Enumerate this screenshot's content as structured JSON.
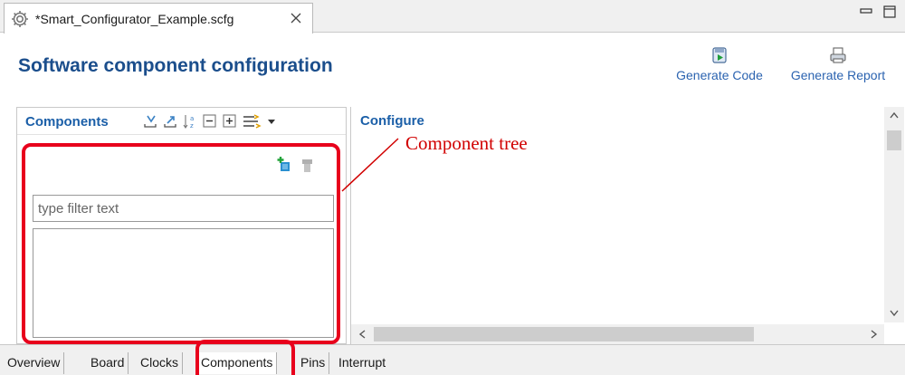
{
  "editor_tab": {
    "title": "*Smart_Configurator_Example.scfg"
  },
  "header": {
    "title": "Software component configuration",
    "generate_code_label": "Generate Code",
    "generate_report_label": "Generate Report"
  },
  "components_panel": {
    "title": "Components",
    "filter_placeholder": "type filter text"
  },
  "configure_panel": {
    "title": "Configure"
  },
  "annotation": {
    "label": "Component tree"
  },
  "page_tabs": [
    "Overview",
    "Board",
    "Clocks",
    "Components",
    "Pins",
    "Interrupt"
  ],
  "active_page_tab": "Components",
  "colors": {
    "title_blue": "#1b4e8c",
    "panel_title_blue": "#1b5fa8",
    "annotation_red": "#e8001c"
  },
  "icons": [
    "gear-icon",
    "close-icon",
    "minimize-icon",
    "maximize-icon",
    "generate-code-icon",
    "generate-report-icon",
    "add-component-icon",
    "remove-component-icon"
  ]
}
